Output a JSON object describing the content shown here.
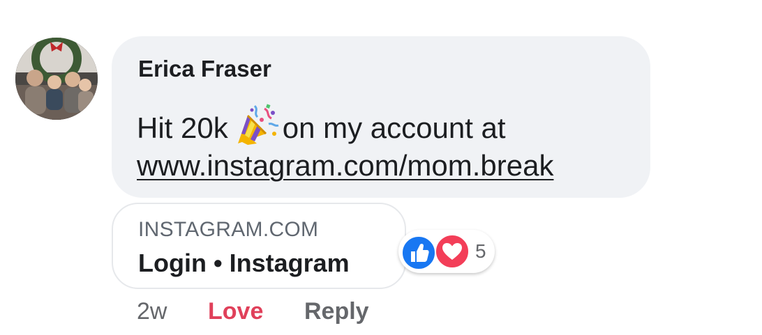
{
  "comment": {
    "author": "Erica Fraser",
    "text_before_emoji": "Hit 20k",
    "emoji": "party-popper-icon",
    "text_after_emoji": "on my account at",
    "link_text": "www.instagram.com/mom.break"
  },
  "link_preview": {
    "domain": "INSTAGRAM.COM",
    "title": "Login • Instagram"
  },
  "reactions": {
    "types": [
      "like-icon",
      "love-icon"
    ],
    "count": "5"
  },
  "actions": {
    "timestamp": "2w",
    "love_label": "Love",
    "reply_label": "Reply"
  },
  "colors": {
    "bubble_bg": "#f0f2f5",
    "text": "#1c1e21",
    "secondary_text": "#65676b",
    "like_blue": "#1877f2",
    "love_red": "#f33e58",
    "love_action": "#e0405a"
  }
}
